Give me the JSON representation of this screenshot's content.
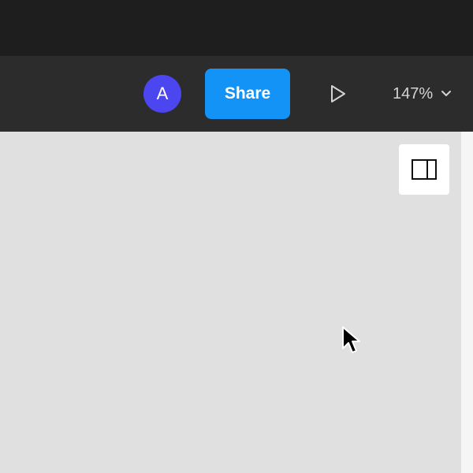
{
  "colors": {
    "title_bar_bg": "#1e1e1e",
    "toolbar_bg": "#2c2c2c",
    "canvas_bg": "#e0e0e0",
    "avatar_bg": "#4c46f0",
    "share_bg": "#1493f7"
  },
  "toolbar": {
    "avatar_initial": "A",
    "share_label": "Share",
    "present_icon": "play-icon",
    "zoom_value": "147%",
    "zoom_icon": "chevron-down-icon"
  },
  "canvas": {
    "panel_toggle_icon": "right-sidebar-icon",
    "cursor_icon": "mouse-pointer-icon"
  }
}
